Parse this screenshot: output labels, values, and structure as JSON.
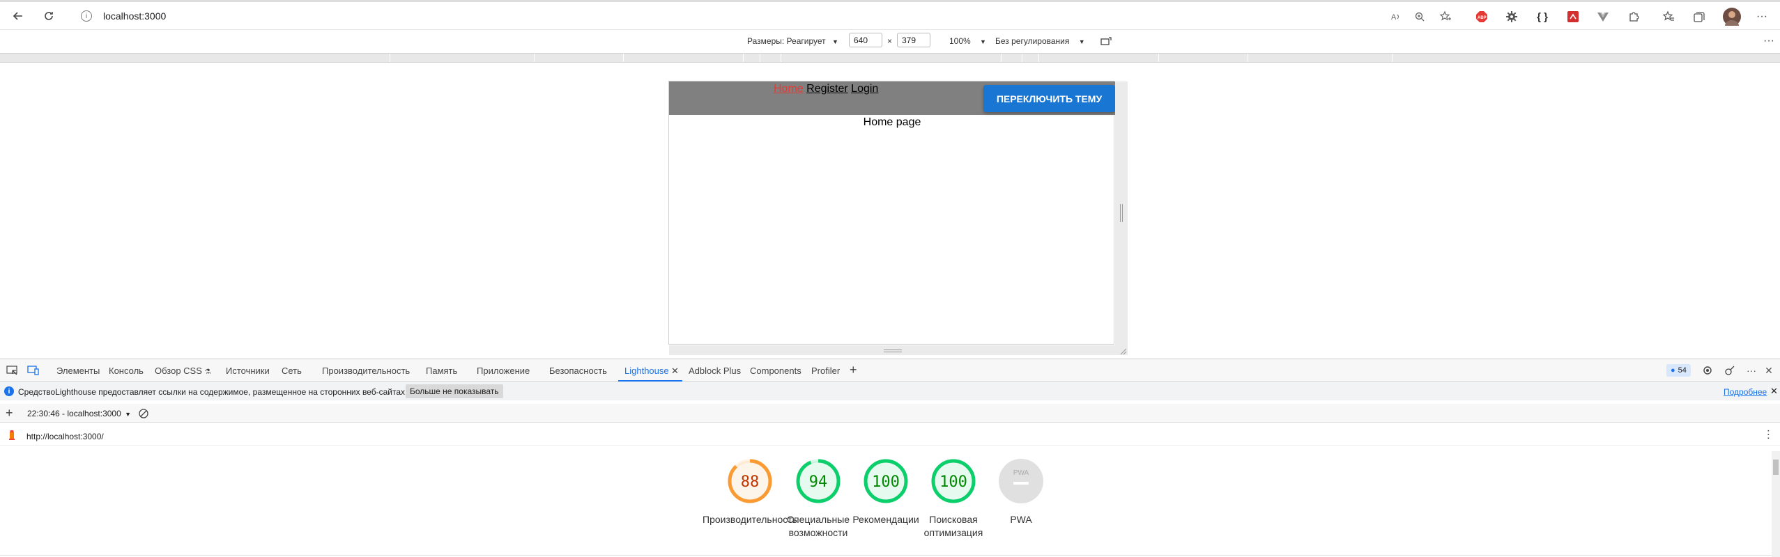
{
  "browser": {
    "url": "localhost:3000"
  },
  "device_toolbar": {
    "dimensions_label": "Размеры: Реагирует",
    "width": "640",
    "times": "×",
    "height": "379",
    "zoom": "100%",
    "throttling": "Без регулирования"
  },
  "app": {
    "nav": {
      "home": "Home",
      "register": "Register",
      "login": "Login"
    },
    "theme_button": "ПЕРЕКЛЮЧИТЬ ТЕМУ",
    "page_text": "Home page"
  },
  "devtools": {
    "tabs": [
      "Элементы",
      "Консоль",
      "Обзор CSS",
      "Источники",
      "Сеть",
      "Производительность",
      "Память",
      "Приложение",
      "Безопасность",
      "Lighthouse",
      "Adblock Plus",
      "Components",
      "Profiler"
    ],
    "issues_count": "54",
    "info_text": "СредствоLighthouse предоставляет ссылки на содержимое, размещенное на сторонних веб-сайтах.",
    "info_dismiss": "Больше не показывать",
    "info_more": "Подробнее",
    "report_select": "22:30:46 - localhost:3000",
    "report_url": "http://localhost:3000/"
  },
  "scores": [
    {
      "value": "88",
      "label": "Производительность",
      "color": "#fa9a33"
    },
    {
      "value": "94",
      "label": "Специальные возможности",
      "color": "#0cce6b"
    },
    {
      "value": "100",
      "label": "Рекомендации",
      "color": "#0cce6b"
    },
    {
      "value": "100",
      "label": "Поисковая оптимизация",
      "color": "#0cce6b"
    }
  ],
  "pwa": {
    "badge": "PWA",
    "label": "PWA"
  },
  "colors": {
    "accent": "#1a73e8",
    "theme_button": "#1976d2",
    "header_bg": "#808080",
    "home_link": "#e53935",
    "score_orange": "#fa9a33",
    "score_green": "#0cce6b"
  }
}
